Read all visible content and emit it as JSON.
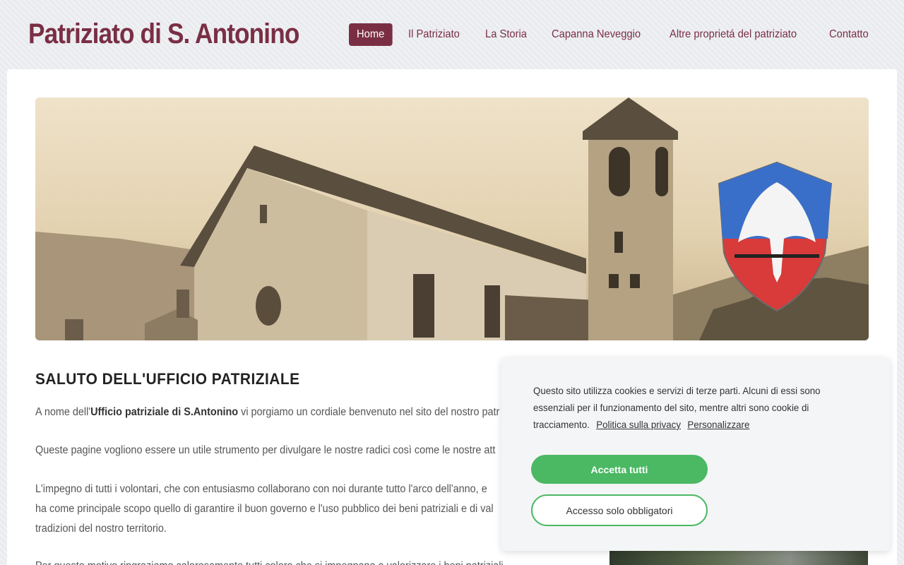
{
  "site": {
    "title": "Patriziato di S. Antonino"
  },
  "nav": {
    "items": [
      {
        "label": "Home"
      },
      {
        "label": "Il Patriziato"
      },
      {
        "label": "La Storia"
      },
      {
        "label": "Capanna Neveggio"
      },
      {
        "label": "Altre proprietá del patriziato"
      },
      {
        "label": "Contatto"
      }
    ]
  },
  "hero": {
    "image": "church-bell-tower-photo",
    "emblem": "eagle-coat-of-arms"
  },
  "content": {
    "heading": "SALUTO DELL'UFFICIO PATRIZIALE",
    "p1_pre": "A nome dell'",
    "p1_bold": "Ufficio patriziale di S.Antonino",
    "p1_post": " vi porgiamo un cordiale benvenuto nel sito del nostro patr",
    "p2": "Queste pagine vogliono essere un utile strumento per divulgare le nostre radici così come le nostre att",
    "p3_line1": "L'impegno di tutti i volontari, che con entusiasmo collaborano con noi durante tutto l'arco dell'anno, e",
    "p3_line2": "ha come principale scopo quello di garantire il buon governo e l'uso pubblico dei beni patriziali e di val",
    "p3_line3": "tradizioni del nostro territorio.",
    "p4": "Per questo motivo ringraziamo calorosamente tutti coloro che si impegnano a valorizzare i beni patriziali"
  },
  "cookie": {
    "text": "Questo sito utilizza cookies e servizi di terze parti. Alcuni di essi sono essenziali per il funzionamento del sito, mentre altri sono cookie di tracciamento.",
    "privacy_link": "Politica sulla privacy",
    "customize_link": "Personalizzare",
    "accept_label": "Accetta tutti",
    "required_label": "Accesso solo obbligatori"
  },
  "colors": {
    "brand": "#7a2e44",
    "accept": "#4bb863"
  }
}
